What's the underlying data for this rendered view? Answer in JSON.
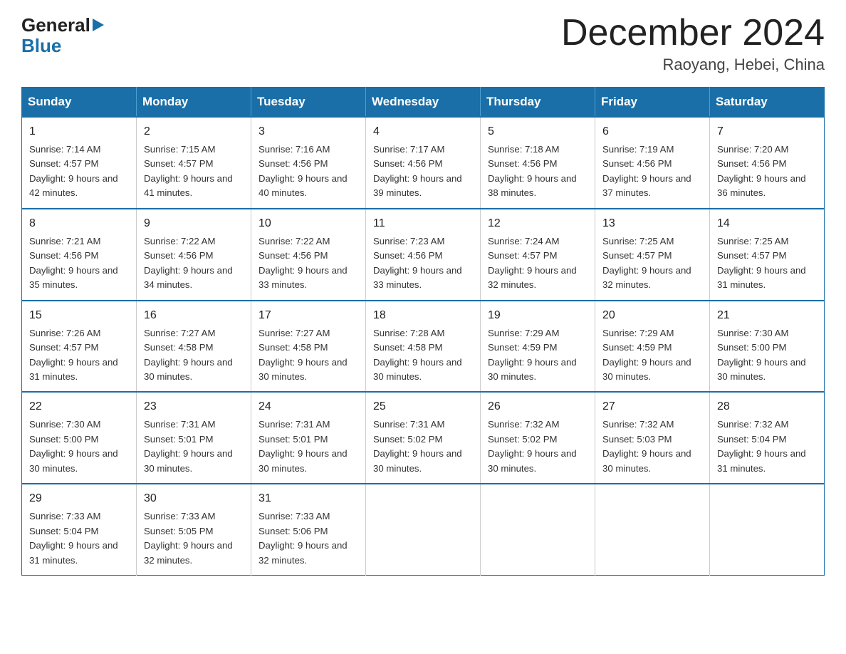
{
  "logo": {
    "general": "General",
    "arrow": "▶",
    "blue": "Blue"
  },
  "header": {
    "title": "December 2024",
    "subtitle": "Raoyang, Hebei, China"
  },
  "calendar": {
    "days": [
      "Sunday",
      "Monday",
      "Tuesday",
      "Wednesday",
      "Thursday",
      "Friday",
      "Saturday"
    ],
    "weeks": [
      [
        {
          "date": "1",
          "sunrise": "Sunrise: 7:14 AM",
          "sunset": "Sunset: 4:57 PM",
          "daylight": "Daylight: 9 hours and 42 minutes."
        },
        {
          "date": "2",
          "sunrise": "Sunrise: 7:15 AM",
          "sunset": "Sunset: 4:57 PM",
          "daylight": "Daylight: 9 hours and 41 minutes."
        },
        {
          "date": "3",
          "sunrise": "Sunrise: 7:16 AM",
          "sunset": "Sunset: 4:56 PM",
          "daylight": "Daylight: 9 hours and 40 minutes."
        },
        {
          "date": "4",
          "sunrise": "Sunrise: 7:17 AM",
          "sunset": "Sunset: 4:56 PM",
          "daylight": "Daylight: 9 hours and 39 minutes."
        },
        {
          "date": "5",
          "sunrise": "Sunrise: 7:18 AM",
          "sunset": "Sunset: 4:56 PM",
          "daylight": "Daylight: 9 hours and 38 minutes."
        },
        {
          "date": "6",
          "sunrise": "Sunrise: 7:19 AM",
          "sunset": "Sunset: 4:56 PM",
          "daylight": "Daylight: 9 hours and 37 minutes."
        },
        {
          "date": "7",
          "sunrise": "Sunrise: 7:20 AM",
          "sunset": "Sunset: 4:56 PM",
          "daylight": "Daylight: 9 hours and 36 minutes."
        }
      ],
      [
        {
          "date": "8",
          "sunrise": "Sunrise: 7:21 AM",
          "sunset": "Sunset: 4:56 PM",
          "daylight": "Daylight: 9 hours and 35 minutes."
        },
        {
          "date": "9",
          "sunrise": "Sunrise: 7:22 AM",
          "sunset": "Sunset: 4:56 PM",
          "daylight": "Daylight: 9 hours and 34 minutes."
        },
        {
          "date": "10",
          "sunrise": "Sunrise: 7:22 AM",
          "sunset": "Sunset: 4:56 PM",
          "daylight": "Daylight: 9 hours and 33 minutes."
        },
        {
          "date": "11",
          "sunrise": "Sunrise: 7:23 AM",
          "sunset": "Sunset: 4:56 PM",
          "daylight": "Daylight: 9 hours and 33 minutes."
        },
        {
          "date": "12",
          "sunrise": "Sunrise: 7:24 AM",
          "sunset": "Sunset: 4:57 PM",
          "daylight": "Daylight: 9 hours and 32 minutes."
        },
        {
          "date": "13",
          "sunrise": "Sunrise: 7:25 AM",
          "sunset": "Sunset: 4:57 PM",
          "daylight": "Daylight: 9 hours and 32 minutes."
        },
        {
          "date": "14",
          "sunrise": "Sunrise: 7:25 AM",
          "sunset": "Sunset: 4:57 PM",
          "daylight": "Daylight: 9 hours and 31 minutes."
        }
      ],
      [
        {
          "date": "15",
          "sunrise": "Sunrise: 7:26 AM",
          "sunset": "Sunset: 4:57 PM",
          "daylight": "Daylight: 9 hours and 31 minutes."
        },
        {
          "date": "16",
          "sunrise": "Sunrise: 7:27 AM",
          "sunset": "Sunset: 4:58 PM",
          "daylight": "Daylight: 9 hours and 30 minutes."
        },
        {
          "date": "17",
          "sunrise": "Sunrise: 7:27 AM",
          "sunset": "Sunset: 4:58 PM",
          "daylight": "Daylight: 9 hours and 30 minutes."
        },
        {
          "date": "18",
          "sunrise": "Sunrise: 7:28 AM",
          "sunset": "Sunset: 4:58 PM",
          "daylight": "Daylight: 9 hours and 30 minutes."
        },
        {
          "date": "19",
          "sunrise": "Sunrise: 7:29 AM",
          "sunset": "Sunset: 4:59 PM",
          "daylight": "Daylight: 9 hours and 30 minutes."
        },
        {
          "date": "20",
          "sunrise": "Sunrise: 7:29 AM",
          "sunset": "Sunset: 4:59 PM",
          "daylight": "Daylight: 9 hours and 30 minutes."
        },
        {
          "date": "21",
          "sunrise": "Sunrise: 7:30 AM",
          "sunset": "Sunset: 5:00 PM",
          "daylight": "Daylight: 9 hours and 30 minutes."
        }
      ],
      [
        {
          "date": "22",
          "sunrise": "Sunrise: 7:30 AM",
          "sunset": "Sunset: 5:00 PM",
          "daylight": "Daylight: 9 hours and 30 minutes."
        },
        {
          "date": "23",
          "sunrise": "Sunrise: 7:31 AM",
          "sunset": "Sunset: 5:01 PM",
          "daylight": "Daylight: 9 hours and 30 minutes."
        },
        {
          "date": "24",
          "sunrise": "Sunrise: 7:31 AM",
          "sunset": "Sunset: 5:01 PM",
          "daylight": "Daylight: 9 hours and 30 minutes."
        },
        {
          "date": "25",
          "sunrise": "Sunrise: 7:31 AM",
          "sunset": "Sunset: 5:02 PM",
          "daylight": "Daylight: 9 hours and 30 minutes."
        },
        {
          "date": "26",
          "sunrise": "Sunrise: 7:32 AM",
          "sunset": "Sunset: 5:02 PM",
          "daylight": "Daylight: 9 hours and 30 minutes."
        },
        {
          "date": "27",
          "sunrise": "Sunrise: 7:32 AM",
          "sunset": "Sunset: 5:03 PM",
          "daylight": "Daylight: 9 hours and 30 minutes."
        },
        {
          "date": "28",
          "sunrise": "Sunrise: 7:32 AM",
          "sunset": "Sunset: 5:04 PM",
          "daylight": "Daylight: 9 hours and 31 minutes."
        }
      ],
      [
        {
          "date": "29",
          "sunrise": "Sunrise: 7:33 AM",
          "sunset": "Sunset: 5:04 PM",
          "daylight": "Daylight: 9 hours and 31 minutes."
        },
        {
          "date": "30",
          "sunrise": "Sunrise: 7:33 AM",
          "sunset": "Sunset: 5:05 PM",
          "daylight": "Daylight: 9 hours and 32 minutes."
        },
        {
          "date": "31",
          "sunrise": "Sunrise: 7:33 AM",
          "sunset": "Sunset: 5:06 PM",
          "daylight": "Daylight: 9 hours and 32 minutes."
        },
        null,
        null,
        null,
        null
      ]
    ]
  }
}
